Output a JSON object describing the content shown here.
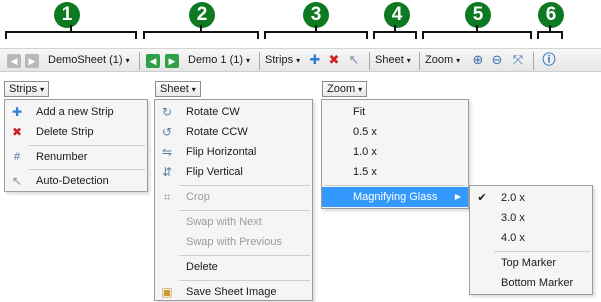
{
  "callouts": [
    "1",
    "2",
    "3",
    "4",
    "5",
    "6"
  ],
  "toolbar": {
    "sheet_selector": "DemoSheet (1)",
    "demo_selector": "Demo 1 (1)",
    "strips_label": "Strips",
    "sheet_label": "Sheet",
    "zoom_label": "Zoom",
    "caret": "▾"
  },
  "strips_menu": {
    "button": "Strips",
    "items": [
      "Add a new Strip",
      "Delete Strip",
      "Renumber",
      "Auto-Detection"
    ]
  },
  "sheet_menu": {
    "button": "Sheet",
    "items": [
      "Rotate CW",
      "Rotate CCW",
      "Flip Horizontal",
      "Flip Vertical",
      "Crop",
      "Swap with Next",
      "Swap with Previous",
      "Delete",
      "Save Sheet Image"
    ]
  },
  "zoom_menu": {
    "button": "Zoom",
    "items": [
      "Fit",
      "0.5 x",
      "1.0 x",
      "1.5 x",
      "Magnifying Glass"
    ]
  },
  "magnifier_menu": {
    "check": "✔",
    "items": [
      "2.0 x",
      "3.0 x",
      "4.0 x",
      "Top Marker",
      "Bottom Marker"
    ]
  },
  "colors": {
    "callout": "#0d7a21",
    "highlight": "#3399ff",
    "green_nav": "#2fa046"
  }
}
